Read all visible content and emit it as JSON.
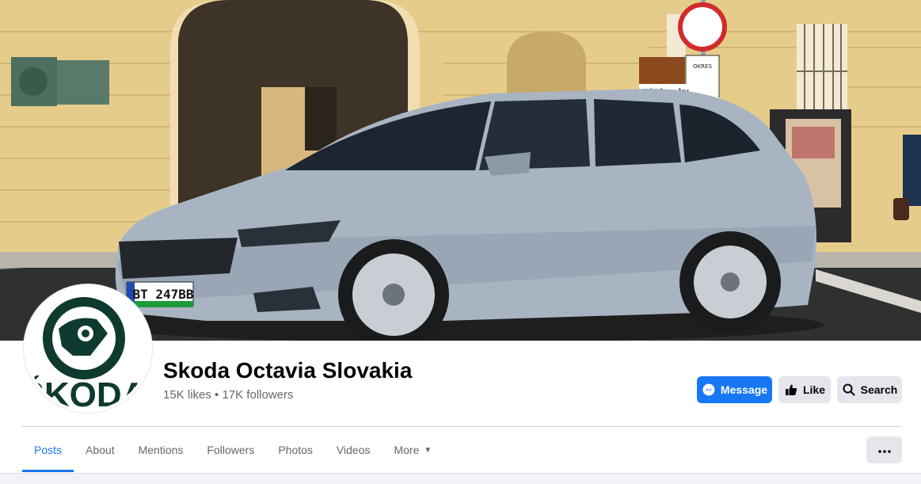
{
  "cover": {
    "plate_text": "BT 247BB",
    "sign_text": "Nitriansky"
  },
  "page": {
    "title": "Skoda Octavia Slovakia",
    "stats": "15K likes • 17K followers"
  },
  "avatar": {
    "logo_text": "ŠKODA"
  },
  "actions": {
    "message_label": "Message",
    "like_label": "Like",
    "search_label": "Search"
  },
  "tabs": [
    {
      "label": "Posts",
      "active": true
    },
    {
      "label": "About"
    },
    {
      "label": "Mentions"
    },
    {
      "label": "Followers"
    },
    {
      "label": "Photos"
    },
    {
      "label": "Videos"
    },
    {
      "label": "More"
    }
  ],
  "colors": {
    "accent": "#1877f2",
    "secondary_button": "#e4e6eb",
    "logo_green": "#0e3a2f"
  },
  "icons": {
    "message": "messenger-icon",
    "like": "thumbs-up-icon",
    "search": "search-icon",
    "more": "caret-down-icon",
    "menu": "ellipsis-icon"
  }
}
